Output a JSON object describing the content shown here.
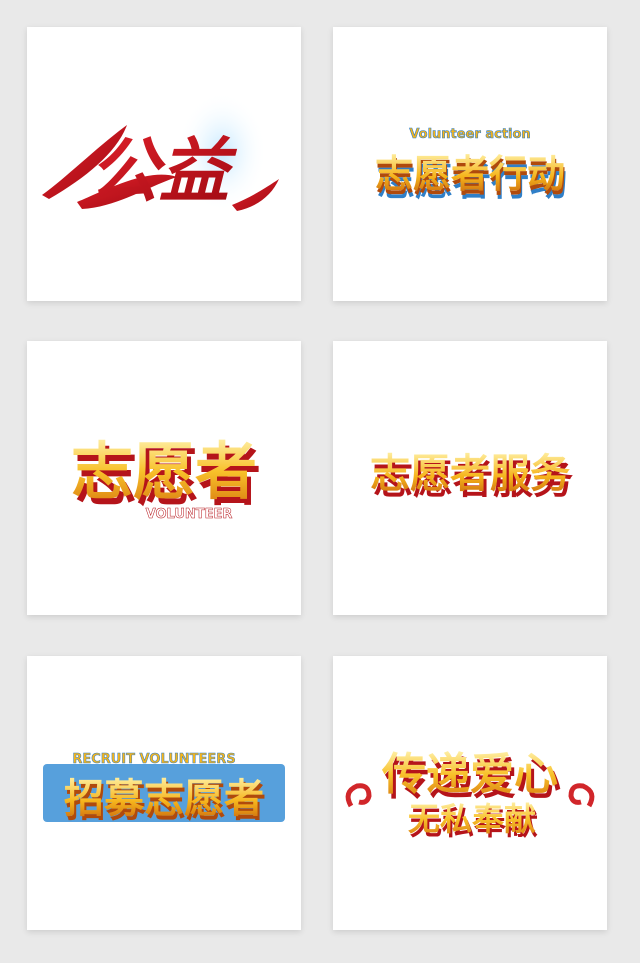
{
  "cards": [
    {
      "title": "公益",
      "subtitle": ""
    },
    {
      "title": "志愿者行动",
      "subtitle": "Volunteer action"
    },
    {
      "title": "志愿者",
      "subtitle": "VOLUNTEER"
    },
    {
      "title": "志愿者服务",
      "subtitle": ""
    },
    {
      "title": "招募志愿者",
      "subtitle": "RECRUIT VOLUNTEERS"
    },
    {
      "title": "传递爱心",
      "subtitle": "无私奉献"
    }
  ],
  "colors": {
    "background": "#e9e9e9",
    "card": "#ffffff",
    "ribbon_red": "#c8101a",
    "gold_light": "#fff1a6",
    "gold": "#f6b51c",
    "gold_dark": "#c9660d",
    "blue_edge": "#3a8fd6",
    "red_edge": "#b5141a"
  }
}
